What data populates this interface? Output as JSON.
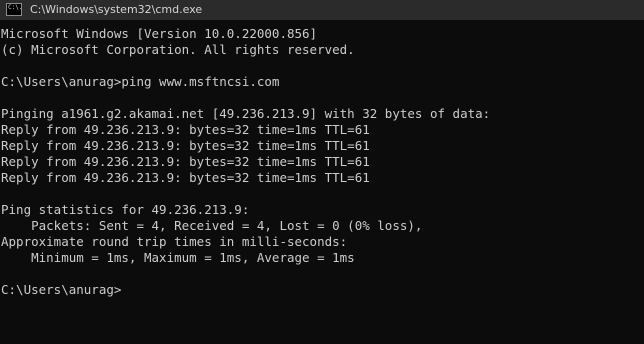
{
  "window": {
    "title": "C:\\Windows\\system32\\cmd.exe",
    "icon": "cmd-icon",
    "icon_text": "C:\\."
  },
  "console": {
    "lines": [
      "Microsoft Windows [Version 10.0.22000.856]",
      "(c) Microsoft Corporation. All rights reserved.",
      "",
      "C:\\Users\\anurag>ping www.msftncsi.com",
      "",
      "Pinging a1961.g2.akamai.net [49.236.213.9] with 32 bytes of data:",
      "Reply from 49.236.213.9: bytes=32 time=1ms TTL=61",
      "Reply from 49.236.213.9: bytes=32 time=1ms TTL=61",
      "Reply from 49.236.213.9: bytes=32 time=1ms TTL=61",
      "Reply from 49.236.213.9: bytes=32 time=1ms TTL=61",
      "",
      "Ping statistics for 49.236.213.9:",
      "    Packets: Sent = 4, Received = 4, Lost = 0 (0% loss),",
      "Approximate round trip times in milli-seconds:",
      "    Minimum = 1ms, Maximum = 1ms, Average = 1ms",
      "",
      "C:\\Users\\anurag>"
    ]
  },
  "colors": {
    "background": "#0c0c0c",
    "text": "#cccccc",
    "titlebar": "#2b2b2b"
  }
}
